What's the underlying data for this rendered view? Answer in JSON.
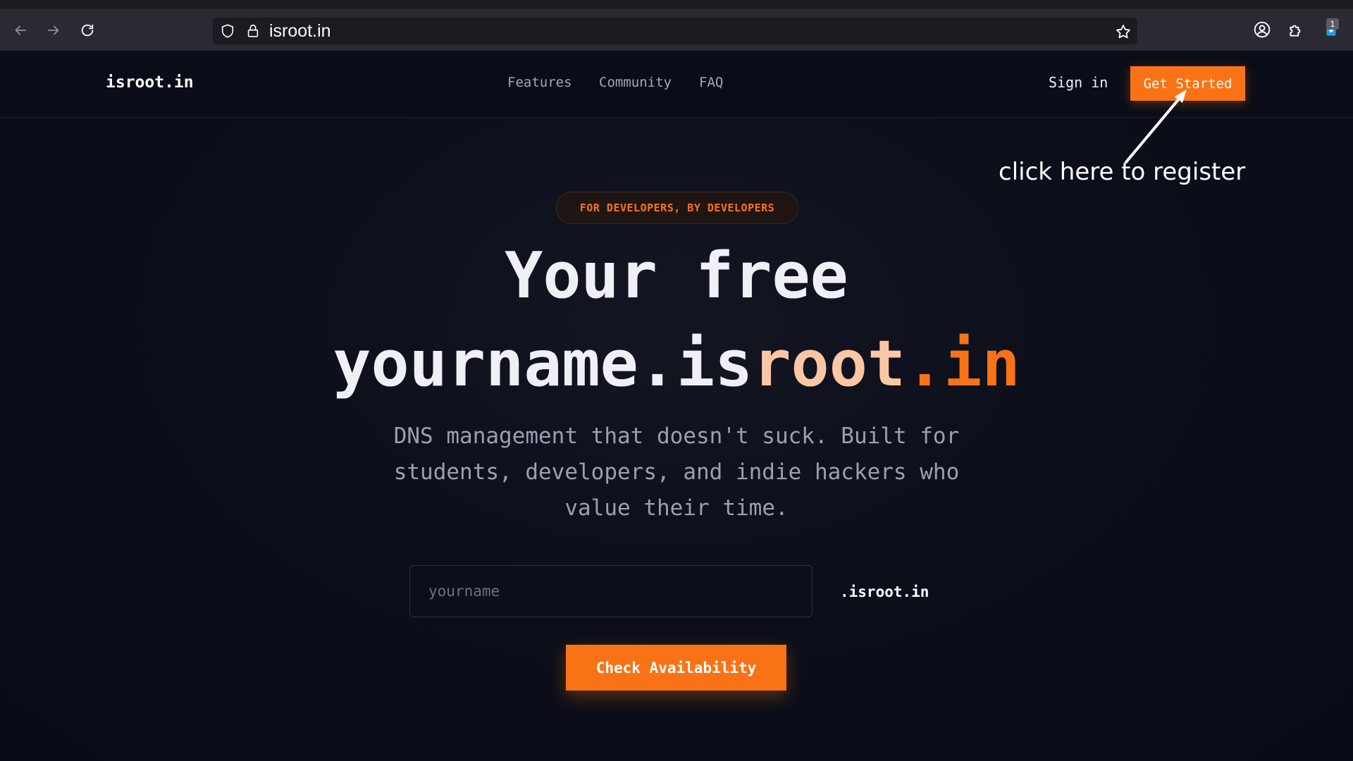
{
  "browser": {
    "url": "isroot.in",
    "extension_badge": "1",
    "icons": [
      "back-arrow-icon",
      "forward-arrow-icon",
      "reload-icon",
      "shield-icon",
      "lock-icon",
      "bookmark-star-icon",
      "account-icon",
      "extensions-icon",
      "extension-icon"
    ]
  },
  "site": {
    "logo": "isroot.in",
    "nav": {
      "features": "Features",
      "community": "Community",
      "faq": "FAQ"
    },
    "sign_in": "Sign in",
    "get_started": "Get Started"
  },
  "annotation": {
    "text": "click here to register"
  },
  "hero": {
    "badge": "FOR DEVELOPERS, BY DEVELOPERS",
    "line1": "Your free",
    "line2_prefix": "yourname.is",
    "line2_root": "root",
    "line2_in": ".in",
    "subtitle": "DNS management that doesn't suck. Built for students, developers, and indie hackers who value their time."
  },
  "form": {
    "input_value": "",
    "input_placeholder": "yourname",
    "suffix": ".isroot.in",
    "check_button": "Check Availability"
  },
  "colors": {
    "accent": "#f97316",
    "accent_light": "#fbc6a4",
    "background": "#0a0d17"
  }
}
